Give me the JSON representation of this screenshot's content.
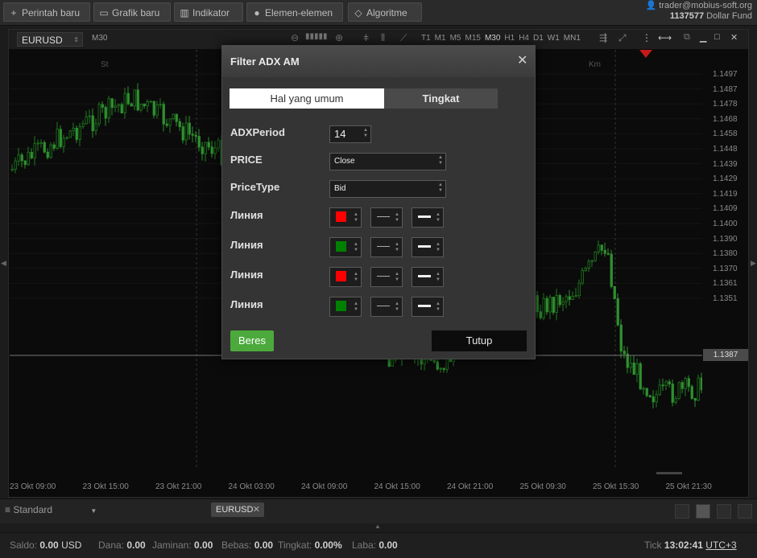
{
  "toolbar": {
    "new_order": "Perintah baru",
    "new_chart": "Grafik baru",
    "indicator": "Indikator",
    "elements": "Elemen-elemen",
    "algorithm": "Algoritme"
  },
  "account": {
    "email": "trader@mobius-soft.org",
    "id": "1137577",
    "name": "Dollar Fund"
  },
  "chart": {
    "symbol": "EURUSD",
    "period": "M30",
    "timeframes": [
      "T1",
      "M1",
      "M5",
      "M15",
      "M30",
      "H1",
      "H4",
      "D1",
      "W1",
      "MN1"
    ],
    "day_left": "St",
    "day_right": "Km",
    "price_labels": [
      "1.1497",
      "1.1487",
      "1.1478",
      "1.1468",
      "1.1458",
      "1.1448",
      "1.1439",
      "1.1429",
      "1.1419",
      "1.1409",
      "1.1400",
      "1.1390",
      "1.1380",
      "1.1370",
      "1.1361",
      "1.1351"
    ],
    "current_price": "1.1387",
    "time_labels": [
      "23 Okt 09:00",
      "23 Okt 15:00",
      "23 Okt 21:00",
      "24 Okt 03:00",
      "24 Okt 09:00",
      "24 Okt 15:00",
      "24 Okt 21:00",
      "25 Okt 09:30",
      "25 Okt 15:30",
      "25 Okt 21:30"
    ],
    "up_color": "#1f7a1f",
    "down_color": "#2f8f2f"
  },
  "tabs": {
    "workspace": "Standard",
    "symbol_tab": "EURUSD"
  },
  "status": {
    "balance_label": "Saldo:",
    "balance": "0.00",
    "currency": "USD",
    "funds_label": "Dana:",
    "funds": "0.00",
    "margin_label": "Jaminan:",
    "margin": "0.00",
    "free_label": "Bebas:",
    "free": "0.00",
    "level_label": "Tingkat:",
    "level": "0.00%",
    "profit_label": "Laba:",
    "profit": "0.00",
    "tick_label": "Tick",
    "time": "13:02:41",
    "tz": "UTC+3"
  },
  "dialog": {
    "title": "Filter ADX AM",
    "tab_general": "Hal yang umum",
    "tab_level": "Tingkat",
    "adx_period_label": "ADXPeriod",
    "adx_period_value": "14",
    "price_label": "PRICE",
    "price_value": "Close",
    "price_type_label": "PriceType",
    "price_type_value": "Bid",
    "lines": [
      {
        "label": "Линия",
        "color": "#ff0000"
      },
      {
        "label": "Линия",
        "color": "#008000"
      },
      {
        "label": "Линия",
        "color": "#ff0000"
      },
      {
        "label": "Линия",
        "color": "#008000"
      }
    ],
    "ok_label": "Beres",
    "close_label": "Tutup"
  }
}
